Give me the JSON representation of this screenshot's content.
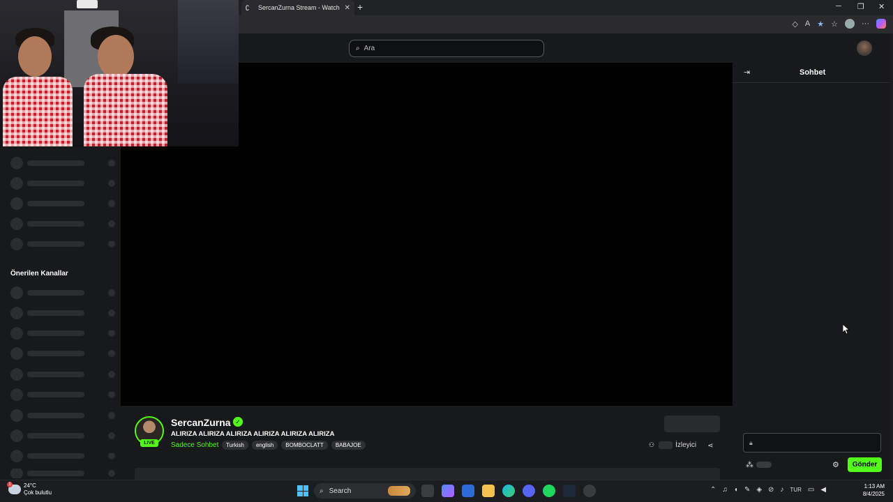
{
  "browser": {
    "tab_title": "SercanZurna Stream - Watch Live",
    "tab_favicon": "kick-icon",
    "new_tab": "+",
    "window_controls": {
      "minimize": "─",
      "maximize": "❐",
      "close": "✕"
    }
  },
  "site": {
    "search_placeholder": "Ara",
    "accent_color": "#53fc18"
  },
  "sidebar": {
    "section_recommended": "Önerilen Kanallar"
  },
  "channel": {
    "name": "SercanZurna",
    "verified": "✓",
    "live_label": "LIVE",
    "stream_title": "ALIRIZA ALIRIZA ALIRIZA ALIRIZA ALIRIZA ALIRIZA",
    "category": "Sadece Sohbet",
    "tags": [
      "Turkish",
      "english",
      "BOMBOCLATT",
      "BABAJOE"
    ],
    "viewers_label": "İzleyici"
  },
  "chat": {
    "title": "Sohbet",
    "send_label": "Gönder"
  },
  "taskbar": {
    "weather_temp": "24°C",
    "weather_desc": "Çok bulutlu",
    "weather_badge": "1",
    "search_label": "Search",
    "language": "TUR",
    "time": "1:13 AM",
    "date": "8/4/2025"
  }
}
